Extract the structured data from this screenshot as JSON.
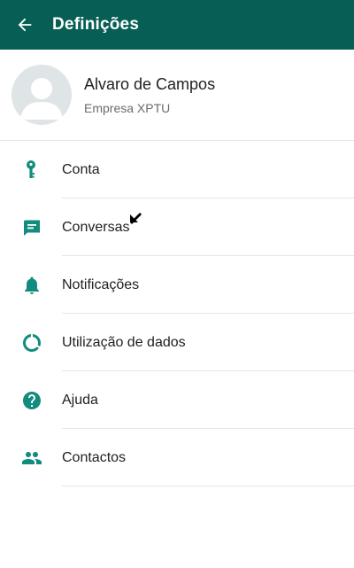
{
  "app_bar": {
    "title": "Definições",
    "back_icon": "arrow-back-icon",
    "background": "#075e54"
  },
  "profile": {
    "name": "Alvaro de Campos",
    "status": "Empresa XPTU",
    "avatar_icon": "avatar-placeholder-icon"
  },
  "menu": {
    "accent": "#128c7e",
    "items": [
      {
        "icon": "key-icon",
        "label": "Conta"
      },
      {
        "icon": "chat-icon",
        "label": "Conversas"
      },
      {
        "icon": "bell-icon",
        "label": "Notificações"
      },
      {
        "icon": "data-usage-icon",
        "label": "Utilização de dados"
      },
      {
        "icon": "help-icon",
        "label": "Ajuda"
      },
      {
        "icon": "contacts-icon",
        "label": "Contactos"
      }
    ]
  }
}
